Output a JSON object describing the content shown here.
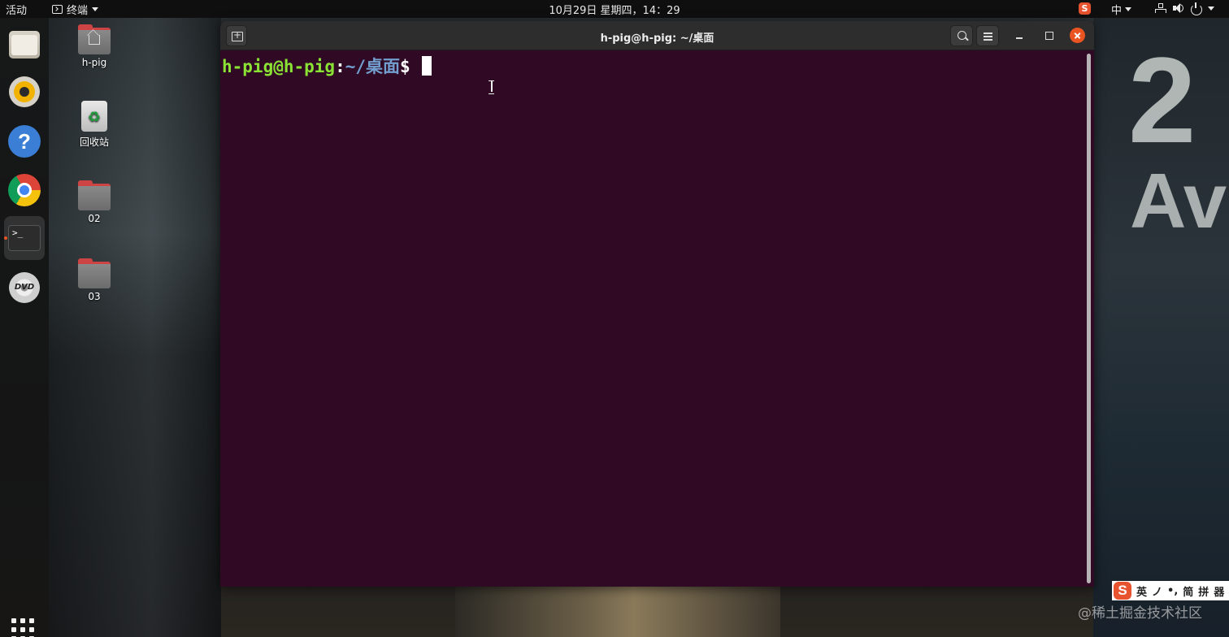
{
  "topbar": {
    "activities": "活动",
    "app_menu_label": "终端",
    "clock": "10月29日 星期四，14：29",
    "ime_label": "中"
  },
  "dock": {
    "items": [
      {
        "name": "files",
        "icon": "files-icon"
      },
      {
        "name": "rhythmbox",
        "icon": "rhythmbox-icon"
      },
      {
        "name": "help",
        "icon": "help-icon",
        "glyph": "?"
      },
      {
        "name": "chrome",
        "icon": "chrome-icon"
      },
      {
        "name": "terminal",
        "icon": "terminal-icon",
        "glyph": ">_"
      },
      {
        "name": "dvd",
        "icon": "dvd-icon",
        "glyph": "DVD"
      }
    ]
  },
  "desktop": {
    "icons": [
      {
        "label": "h-pig",
        "icon": "home-folder-icon"
      },
      {
        "label": "回收站",
        "icon": "trash-icon"
      },
      {
        "label": "02",
        "icon": "folder-icon"
      },
      {
        "label": "03",
        "icon": "folder-icon"
      }
    ]
  },
  "wallpaper": {
    "sign_number": "2",
    "sign_text": "Ave"
  },
  "terminal": {
    "title": "h-pig@h-pig: ~/桌面",
    "prompt_user": "h-pig@h-pig",
    "prompt_colon": ":",
    "prompt_path": "~/桌面",
    "prompt_symbol": "$",
    "background": "#300a24",
    "user_color": "#8ae234",
    "path_color": "#729fcf"
  },
  "ime_toolbar": {
    "logo": "S",
    "items": [
      "英",
      "ノ",
      "•,",
      "简",
      "拼",
      "器"
    ]
  },
  "watermark": "@稀土掘金技术社区",
  "colors": {
    "accent": "#e95420",
    "topbar": "#0f0f0f",
    "titlebar": "#2d2d2d"
  }
}
